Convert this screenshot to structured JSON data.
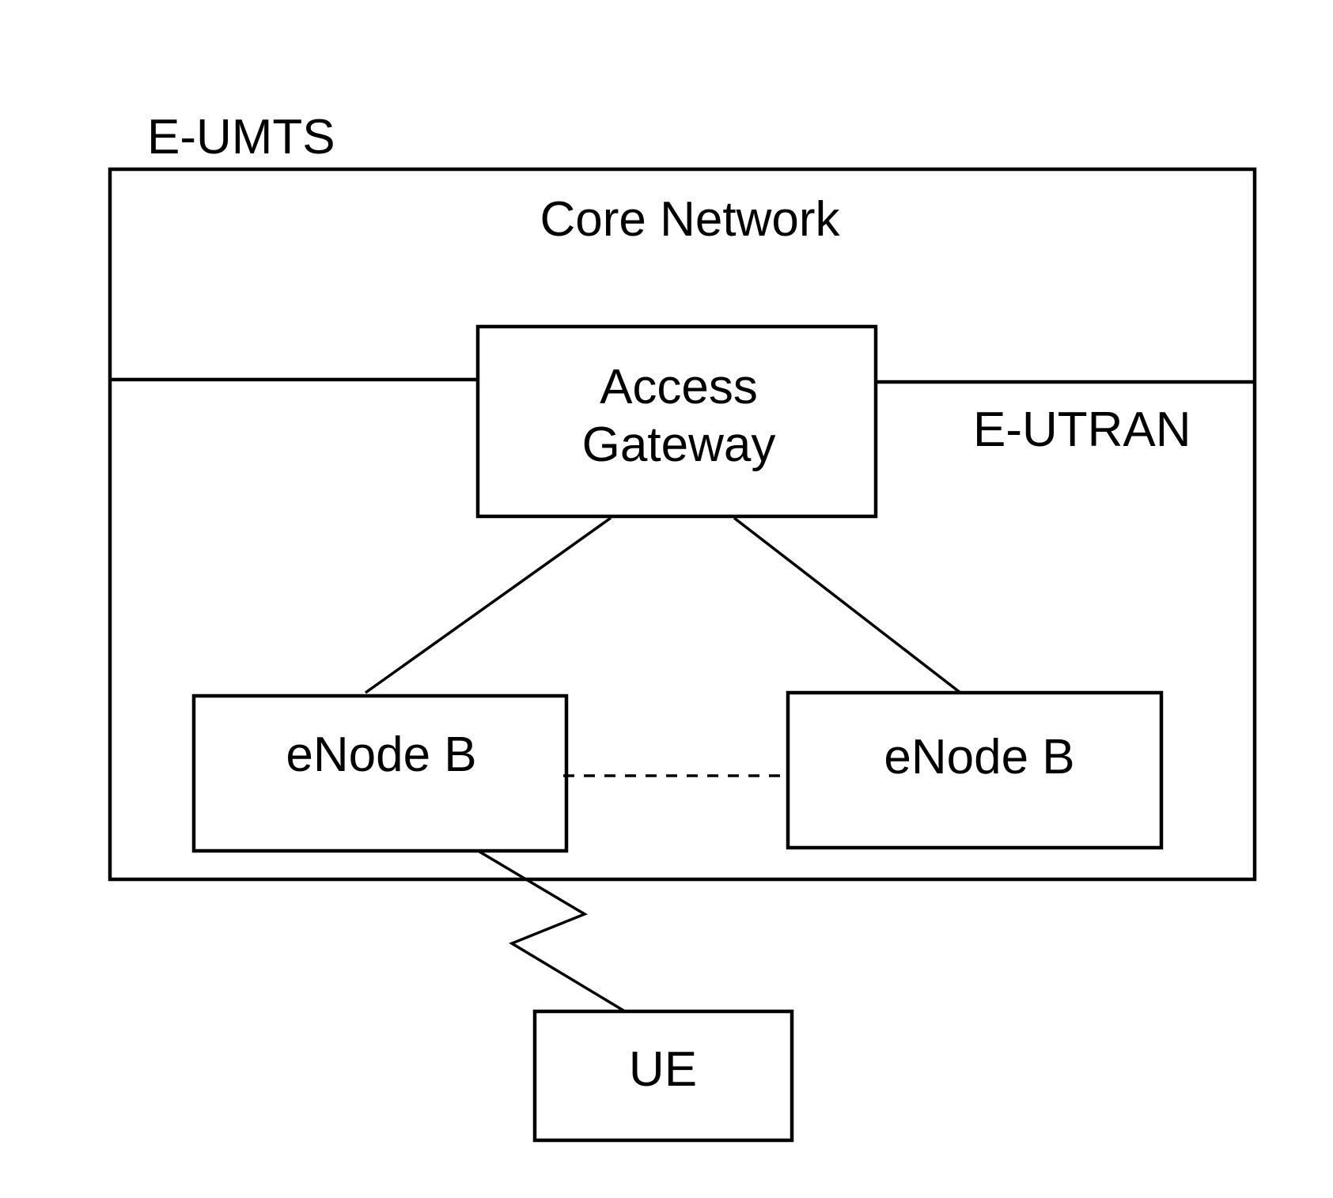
{
  "diagram": {
    "title_label": "E-UMTS",
    "regions": {
      "core_network": "Core Network",
      "e_utran": "E-UTRAN"
    },
    "nodes": {
      "access_gateway": {
        "line1": "Access",
        "line2": "Gateway"
      },
      "enodeb_left": "eNode B",
      "enodeb_right": "eNode B",
      "ue": "UE"
    },
    "connections": [
      {
        "from": "access_gateway",
        "to": "enodeb_left",
        "style": "solid"
      },
      {
        "from": "access_gateway",
        "to": "enodeb_right",
        "style": "solid"
      },
      {
        "from": "enodeb_left",
        "to": "enodeb_right",
        "style": "dashed"
      },
      {
        "from": "enodeb_left",
        "to": "ue",
        "style": "radio-zigzag"
      }
    ],
    "colors": {
      "stroke": "#000000",
      "background": "#ffffff"
    }
  }
}
